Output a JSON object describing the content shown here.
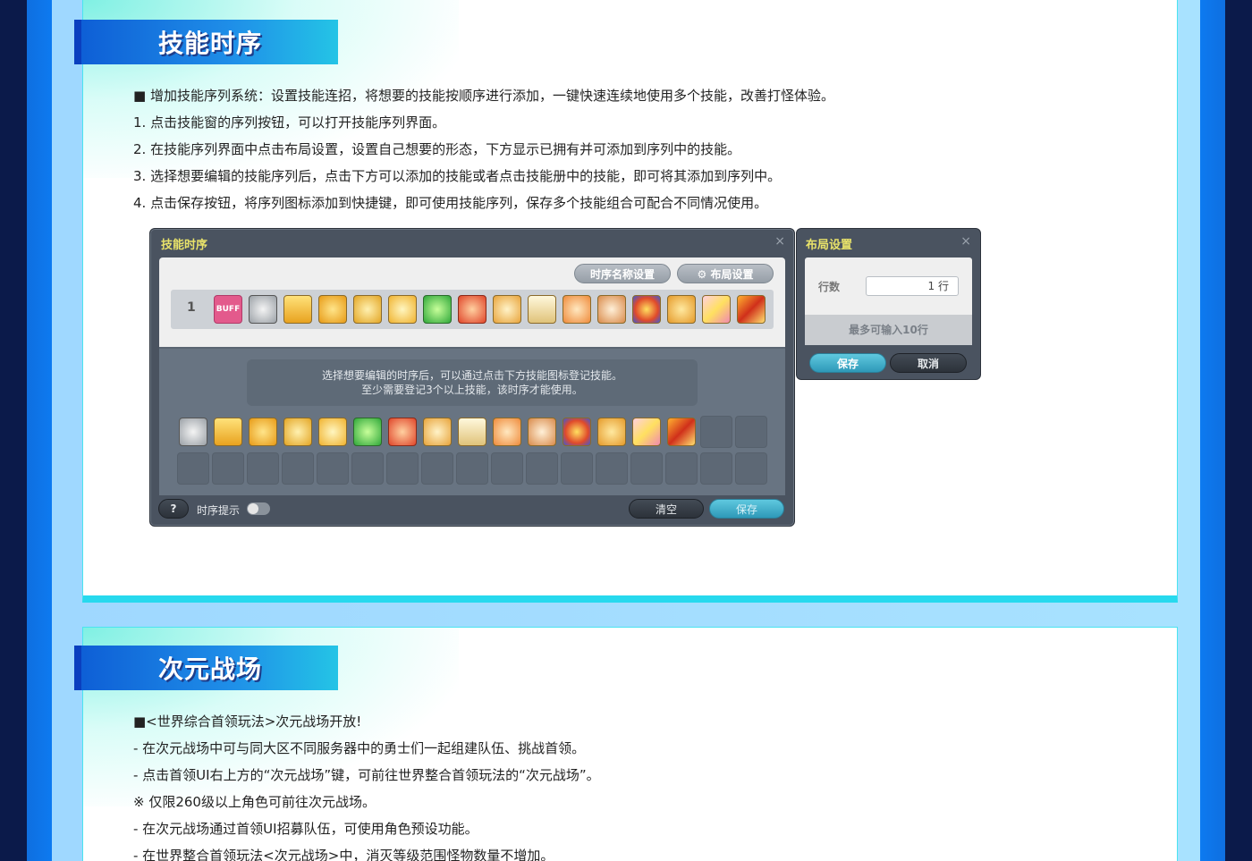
{
  "sections": {
    "skill_sequence": {
      "title": "技能时序",
      "lines": [
        "■ 增加技能序列系统：设置技能连招，将想要的技能按顺序进行添加，一键快速连续地使用多个技能，改善打怪体验。",
        "1. 点击技能窗的序列按钮，可以打开技能序列界面。",
        "2. 在技能序列界面中点击布局设置，设置自己想要的形态，下方显示已拥有并可添加到序列中的技能。",
        "3. 选择想要编辑的技能序列后，点击下方可以添加的技能或者点击技能册中的技能，即可将其添加到序列中。",
        "4. 点击保存按钮，将序列图标添加到快捷键，即可使用技能序列，保存多个技能组合可配合不同情况使用。"
      ]
    },
    "dimension_battlefield": {
      "title": "次元战场",
      "lines": [
        "■<世界综合首领玩法>次元战场开放!",
        "- 在次元战场中可与同大区不同服务器中的勇士们一起组建队伍、挑战首领。",
        "- 点击首领UI右上方的“次元战场”键，可前往世界整合首领玩法的“次元战场”。",
        "※ 仅限260级以上角色可前往次元战场。",
        "- 在次元战场通过首领UI招募队伍，可使用角色预设功能。",
        "- 在世界整合首领玩法<次元战场>中，消灭等级范围怪物数量不增加。"
      ]
    }
  },
  "skill_window": {
    "title": "技能时序",
    "close": "×",
    "name_settings_button": "时序名称设置",
    "layout_settings_button": "⚙ 布局设置",
    "row_number": "1",
    "buff_icon_label": "BUFF",
    "hint_line1": "选择想要编辑的时序后，可以通过点击下方技能图标登记技能。",
    "hint_line2": "至少需要登记3个以上技能，该时序才能使用。",
    "help_button": "?",
    "sequence_hint_label": "时序提示",
    "clear_button": "清空",
    "save_button": "保存"
  },
  "layout_window": {
    "title": "布局设置",
    "close": "×",
    "rows_label": "行数",
    "rows_value": "1 行",
    "max_hint": "最多可输入10行",
    "save_button": "保存",
    "cancel_button": "取消"
  },
  "colors": {
    "title_yellow": "#e9e36a",
    "panel_border": "#27d9ee",
    "accent_blue": "#0e5fd6"
  }
}
